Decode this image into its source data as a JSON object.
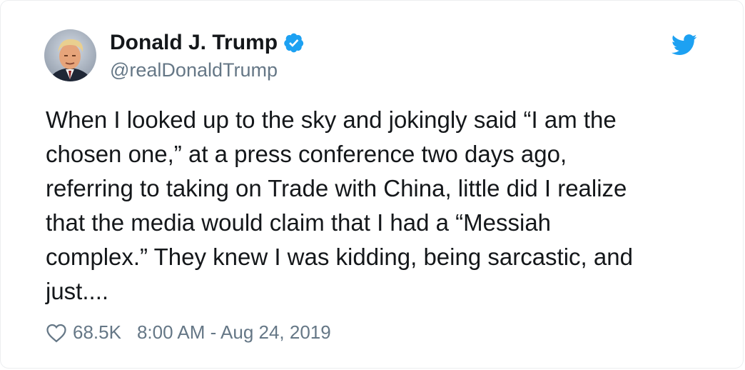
{
  "tweet": {
    "author_name": "Donald J. Trump",
    "handle": "@realDonaldTrump",
    "verified": true,
    "text_lines": [
      "When I looked up to the sky and jokingly said “I am the",
      "chosen one,” at a press conference two days ago,",
      "referring to taking on Trade with China, little did I realize",
      "that the media would claim that I had a “Messiah",
      "complex.” They knew I was kidding, being sarcastic, and",
      "just...."
    ],
    "likes": "68.5K",
    "timestamp": "8:00 AM - Aug 24, 2019"
  },
  "icons": {
    "verified": "verified-badge-icon",
    "bird": "twitter-bird-icon",
    "like": "heart-icon"
  },
  "colors": {
    "text": "#14171a",
    "secondary": "#657786",
    "brand_blue": "#1da1f2"
  }
}
